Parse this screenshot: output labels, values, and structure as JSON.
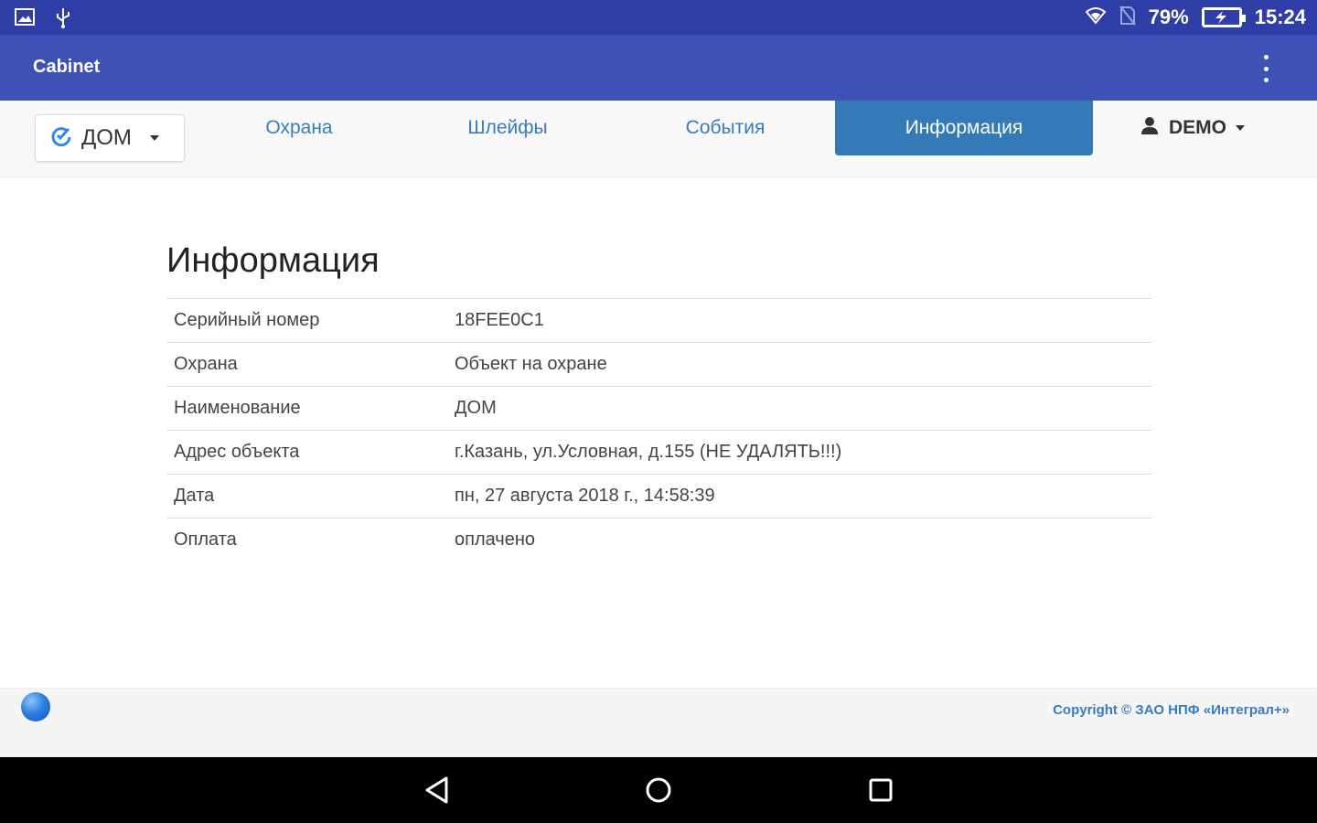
{
  "status_bar": {
    "battery_percent": "79%",
    "time": "15:24",
    "icons": [
      "image-icon",
      "usb-icon",
      "wifi-icon",
      "no-sim-icon",
      "battery-charging-icon"
    ]
  },
  "app_bar": {
    "title": "Cabinet",
    "overflow_icon": "more-vert-icon"
  },
  "nav": {
    "object_select": {
      "value": "ДОМ",
      "icon": "refresh-status-icon"
    },
    "tabs": [
      {
        "label": "Охрана",
        "active": false
      },
      {
        "label": "Шлейфы",
        "active": false
      },
      {
        "label": "События",
        "active": false
      },
      {
        "label": "Информация",
        "active": true
      }
    ],
    "user_menu": {
      "label": "DEMO",
      "icon": "user-icon"
    }
  },
  "main": {
    "title": "Информация",
    "rows": [
      {
        "key": "Серийный номер",
        "value": "18FEE0C1"
      },
      {
        "key": "Охрана",
        "value": "Объект на охране"
      },
      {
        "key": "Наименование",
        "value": "ДОМ"
      },
      {
        "key": "Адрес объекта",
        "value": "г.Казань, ул.Условная, д.155 (НЕ УДАЛЯТЬ!!!)"
      },
      {
        "key": "Дата",
        "value": "пн, 27 августа 2018 г., 14:58:39"
      },
      {
        "key": "Оплата",
        "value": "оплачено"
      }
    ]
  },
  "footer": {
    "copyright": "Copyright © ЗАО НПФ «Интеграл+»",
    "status_indicator_icon": "blue-ball-icon"
  },
  "system_nav": {
    "buttons": [
      "back-icon",
      "home-icon",
      "recents-icon"
    ]
  },
  "colors": {
    "status_bar": "#2f3ea6",
    "app_bar": "#3e51b5",
    "active_tab": "#337ab7",
    "link": "#3a7bc0"
  }
}
